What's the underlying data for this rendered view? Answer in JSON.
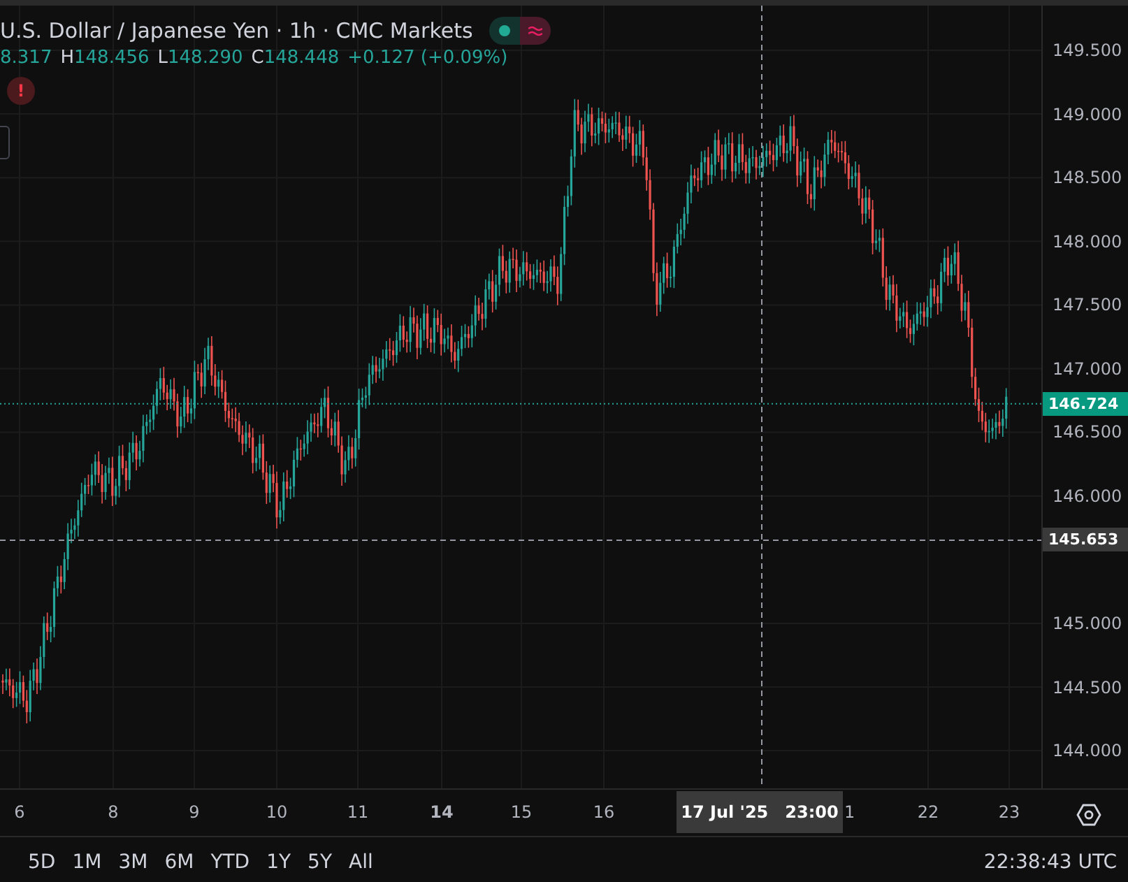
{
  "legend": {
    "title": "U.S. Dollar / Japanese Yen · 1h · CMC Markets",
    "market_open": true,
    "ohlc": [
      {
        "value": "8.317"
      },
      {
        "label": "H",
        "value": "148.456"
      },
      {
        "label": "L",
        "value": "148.290"
      },
      {
        "label": "C",
        "value": "148.448"
      }
    ],
    "change": "+0.127 (+0.09%)",
    "alert": "!"
  },
  "price_axis": {
    "ticks": [
      "149.500",
      "149.000",
      "148.500",
      "148.000",
      "147.500",
      "147.000",
      "146.500",
      "146.000",
      "145.000",
      "144.500",
      "144.000"
    ],
    "last_price": "146.724",
    "crosshair_price": "145.653"
  },
  "time_axis": {
    "ticks": [
      {
        "label": "6",
        "emphasized": false
      },
      {
        "label": "8",
        "emphasized": false
      },
      {
        "label": "9",
        "emphasized": false
      },
      {
        "label": "10",
        "emphasized": false
      },
      {
        "label": "11",
        "emphasized": false
      },
      {
        "label": "14",
        "emphasized": true
      },
      {
        "label": "15",
        "emphasized": false
      },
      {
        "label": "16",
        "emphasized": false
      },
      {
        "label": "22",
        "emphasized": false
      },
      {
        "label": "23",
        "emphasized": false
      }
    ],
    "crosshair_date": "17 Jul '25",
    "crosshair_time": "23:00",
    "cut_tick": "1"
  },
  "ranges": [
    {
      "label": "5D"
    },
    {
      "label": "1M"
    },
    {
      "label": "3M"
    },
    {
      "label": "6M"
    },
    {
      "label": "YTD"
    },
    {
      "label": "1Y"
    },
    {
      "label": "5Y"
    },
    {
      "label": "All"
    }
  ],
  "clock": "22:38:43 UTC"
}
